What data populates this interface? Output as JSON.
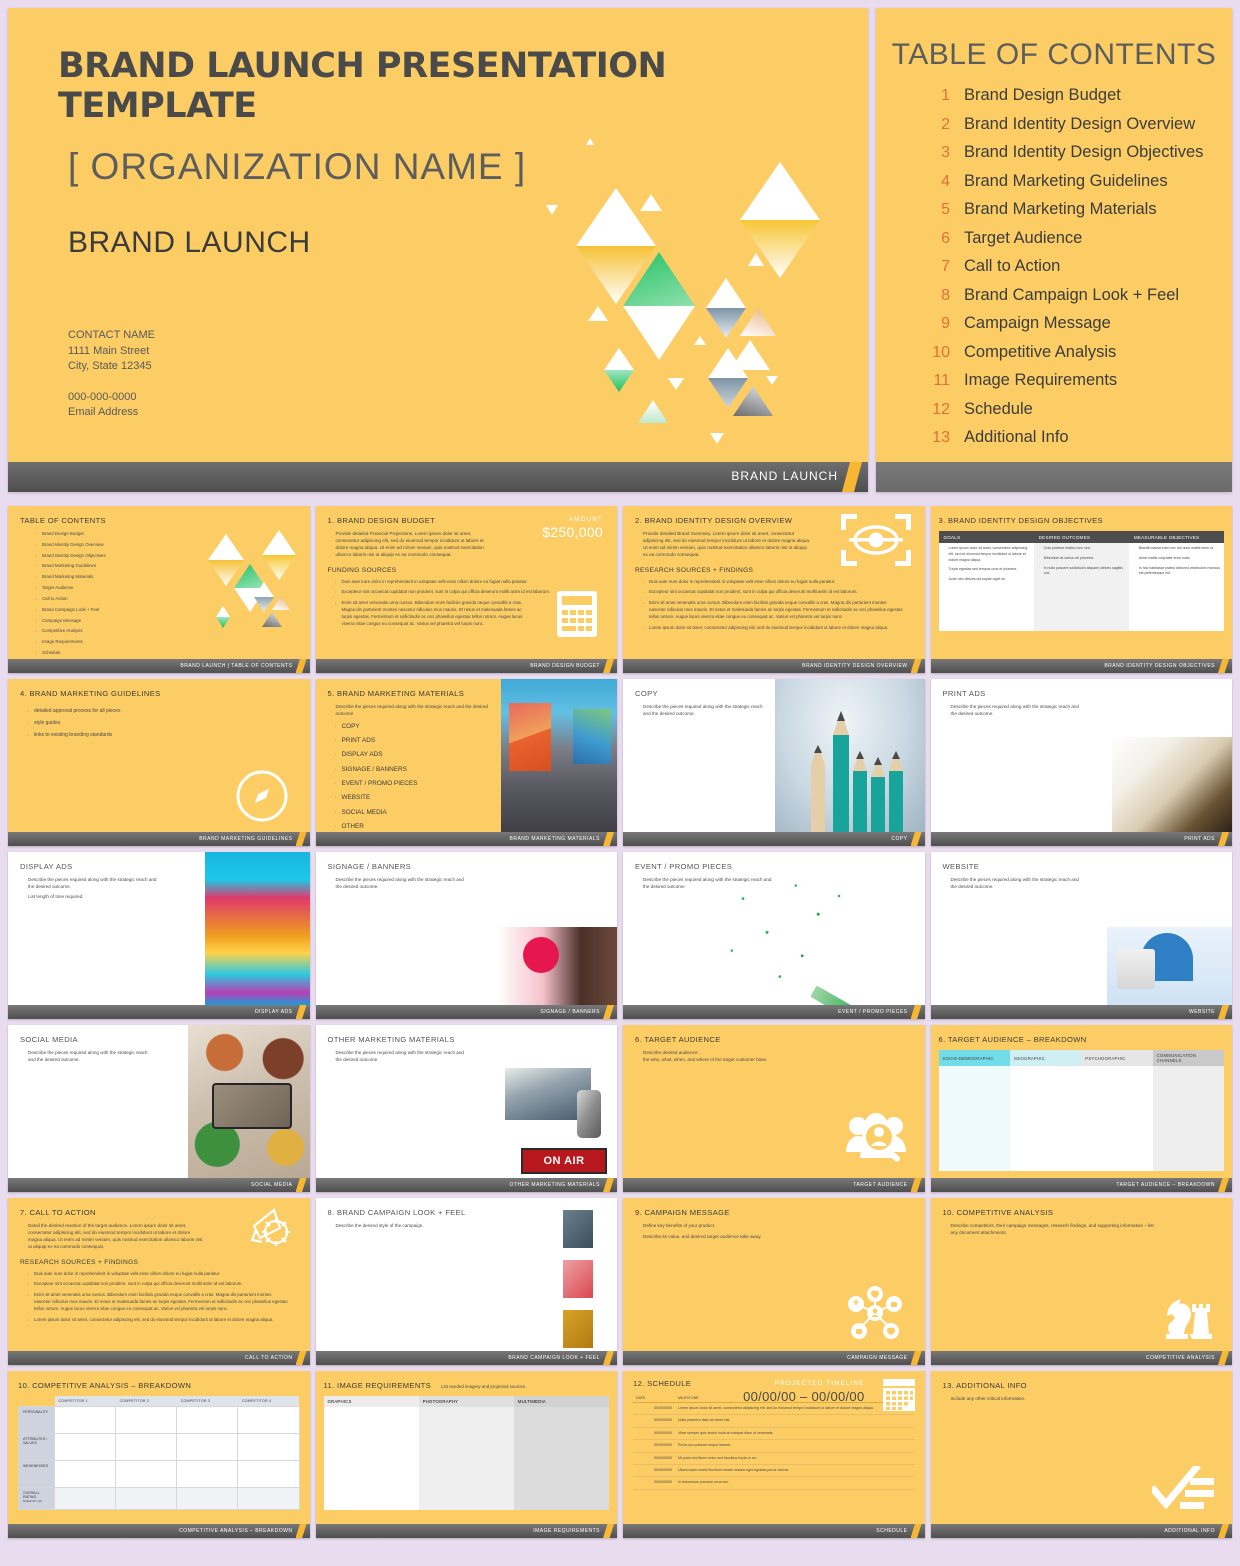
{
  "hero": {
    "title": "BRAND LAUNCH PRESENTATION TEMPLATE",
    "organization": "[ ORGANIZATION NAME ]",
    "subtitle": "BRAND LAUNCH",
    "contact_name": "CONTACT NAME",
    "address_line1": "1111 Main Street",
    "address_line2": "City, State 12345",
    "phone": "000-000-0000",
    "email": "Email Address",
    "footer_label": "BRAND LAUNCH"
  },
  "toc": {
    "heading": "TABLE OF CONTENTS",
    "items": [
      {
        "num": "1",
        "label": "Brand Design Budget"
      },
      {
        "num": "2",
        "label": "Brand Identity Design Overview"
      },
      {
        "num": "3",
        "label": "Brand Identity Design Objectives"
      },
      {
        "num": "4",
        "label": "Brand Marketing Guidelines"
      },
      {
        "num": "5",
        "label": "Brand Marketing Materials"
      },
      {
        "num": "6",
        "label": "Target Audience"
      },
      {
        "num": "7",
        "label": "Call to Action"
      },
      {
        "num": "8",
        "label": "Brand Campaign Look + Feel"
      },
      {
        "num": "9",
        "label": "Campaign Message"
      },
      {
        "num": "10",
        "label": "Competitive Analysis"
      },
      {
        "num": "11",
        "label": "Image Requirements"
      },
      {
        "num": "12",
        "label": "Schedule"
      },
      {
        "num": "13",
        "label": "Additional Info"
      }
    ]
  },
  "colors": {
    "brand_yellow": "#fbcd64",
    "page_background": "#e9dcee",
    "footer_grey": "#4f4f4f",
    "accent_orange": "#e2703a",
    "slash_yellow": "#f7b733"
  },
  "slides": {
    "toc": {
      "title": "TABLE OF CONTENTS",
      "footer": "BRAND LAUNCH  |  TABLE OF CONTENTS"
    },
    "budget": {
      "title": "1. BRAND DESIGN BUDGET",
      "amount_label": "AMOUNT",
      "amount_value": "$250,000",
      "body": "Provide detailed Financial Projections. Lorem ipsum dolor sit amet, consectetur adipiscing elit, sed do eiusmod tempor incididunt ut labore et dolore magna aliqua. Ut enim ad minim veniam, quis nostrud exercitation ullamco laboris nisi ut aliquip ex ea commodo consequat.",
      "section": "FUNDING SOURCES",
      "bullets": [
        "Duis aute irure dolor in reprehenderit in voluptate velit esse cillum dolore eu fugiat nulla pariatur.",
        "Excepteur sint occaecat cupidatat non proident, sunt in culpa qui officia deserunt mollit anim id est laborum.",
        "Enim sit amet venenatis urna cursus. Bibendum enim facilisis gravida neque convallis a cras. Magna dis parturient montes nascetur ridiculus mus mauris. Et netus et malesuada fames ac turpis egestas. Fermentum et sollicitudin ac orci phasellus egestas tellus rutrum. Augue lacus viverra vitae congue eu consequat ac. Varius vel pharetra vel turpis nunc."
      ],
      "footer": "BRAND DESIGN BUDGET"
    },
    "overview": {
      "title": "2. BRAND IDENTITY DESIGN OVERVIEW",
      "body": "Provide detailed Brand Summary. Lorem ipsum dolor sit amet, consectetur adipiscing elit, sed do eiusmod tempor incididunt ut labore et dolore magna aliqua. Ut enim ad minim veniam, quis nostrud exercitation ullamco laboris nisi ut aliquip ex ea commodo consequat.",
      "section": "RESEARCH SOURCES + FINDINGS",
      "bullets": [
        "Duis aute irure dolor in reprehenderit in voluptate velit esse cillum dolore eu fugiat nulla pariatur.",
        "Excepteur sint occaecat cupidatat non proident, sunt in culpa qui officia deserunt mollit anim id est laborum.",
        "Enim sit amet venenatis urna cursus. Bibendum enim facilisis gravida neque convallis a cras. Magna dis parturient montes nascetur ridiculus mus mauris. Et netus et malesuada fames ac turpis egestas. Fermentum et sollicitudin ac orci phasellus egestas tellus rutrum. Augue lacus viverra vitae congue eu consequat ac. Varius vel pharetra vel turpis nunc.",
        "Lorem ipsum dolor sit amet, consectetur adipiscing elit, sed do eiusmod tempor incididunt ut labore et dolore magna aliqua."
      ],
      "footer": "BRAND IDENTITY DESIGN OVERVIEW"
    },
    "objectives": {
      "title": "3. BRAND IDENTITY DESIGN OBJECTIVES",
      "columns": [
        "GOALS",
        "DESIRED OUTCOMES",
        "MEASURABLE OBJECTIVES"
      ],
      "goals": [
        "Lorem ipsum dolor sit amet, consectetur adipiscing elit, sed do eiusmod tempor incididunt ut labore et dolore magna aliqua.",
        "Turpis egestas sed tempus urna et pharetra.",
        "Justo nec ultrices dui sapien eget mi."
      ],
      "outcomes": [
        "Cras pulvinar mattis nunc sed.",
        "Bibendum at varius vel pharetra.",
        "In nulla posuere sollicitudin aliquam ultrices sagittis orci."
      ],
      "measurable": [
        "Blandit massa enim nec dui nunc mattis enim ut.",
        "Amet mattis vulputate enim nulla.",
        "In hac habitasse platea dictumst vestibulum rhoncus est pellentesque elit."
      ],
      "footer": "BRAND IDENTITY DESIGN OBJECTIVES"
    },
    "guidelines": {
      "title": "4. BRAND MARKETING GUIDELINES",
      "bullets": [
        "detailed approval process for all pieces",
        "style guides",
        "links to existing branding standards"
      ],
      "footer": "BRAND MARKETING GUIDELINES"
    },
    "materials": {
      "title": "5. BRAND MARKETING MATERIALS",
      "body": "Describe the pieces required along with the strategic reach and the desired outcome",
      "items": [
        "COPY",
        "PRINT ADS",
        "DISPLAY ADS",
        "SIGNAGE / BANNERS",
        "EVENT / PROMO PIECES",
        "WEBSITE",
        "SOCIAL MEDIA",
        "OTHER"
      ],
      "footer": "BRAND MARKETING MATERIALS"
    },
    "copy": {
      "title": "COPY",
      "body": "Describe the pieces required along with the strategic reach and the desired outcome.",
      "footer": "COPY"
    },
    "print_ads": {
      "title": "PRINT ADS",
      "body": "Describe the pieces required along with the strategic reach and the desired outcome.",
      "footer": "PRINT ADS"
    },
    "display_ads": {
      "title": "DISPLAY ADS",
      "body": "Describe the pieces required along with the strategic reach and the desired outcome.",
      "body2": "List length of time required.",
      "footer": "DISPLAY ADS"
    },
    "signage": {
      "title": "SIGNAGE / BANNERS",
      "body": "Describe the pieces required along with the strategic reach and the desired outcome.",
      "footer": "SIGNAGE / BANNERS"
    },
    "event": {
      "title": "EVENT / PROMO PIECES",
      "body": "Describe the pieces required along with the strategic reach and the desired outcome",
      "footer": "EVENT / PROMO PIECES"
    },
    "website": {
      "title": "WEBSITE",
      "body": "Describe the pieces required along with the strategic reach and the desired outcome.",
      "footer": "WEBSITE"
    },
    "social": {
      "title": "SOCIAL MEDIA",
      "body": "Describe the pieces required along with the strategic reach and the desired outcome.",
      "footer": "SOCIAL MEDIA"
    },
    "other_materials": {
      "title": "OTHER MARKETING MATERIALS",
      "body": "Describe the pieces required along with the strategic reach and the desired outcome.",
      "sign_text": "ON AIR",
      "footer": "OTHER MARKETING MATERIALS"
    },
    "audience": {
      "title": "6. TARGET AUDIENCE",
      "body": "Describe desired audience:\nthe who, what, when, and where of the target customer base.",
      "footer": "TARGET AUDIENCE"
    },
    "audience_breakdown": {
      "title": "6. TARGET AUDIENCE  –  BREAKDOWN",
      "columns": [
        "SOCIO-DEMOGRAPHIC",
        "GEOGRAPHIC",
        "PSYCHOGRAPHIC",
        "COMMUNICATION CHANNELS"
      ],
      "footer": "TARGET AUDIENCE  –  BREAKDOWN"
    },
    "cta": {
      "title": "7. CALL TO ACTION",
      "body": "Detail the desired reaction of the target audience. Lorem ipsum dolor sit amet, consectetur adipiscing elit, sed do eiusmod tempor incididunt ut labore et dolore magna aliqua. Ut enim ad minim veniam, quis nostrud exercitation ullamco laboris nisi ut aliquip ex ea commodo consequat.",
      "section": "RESEARCH SOURCES + FINDINGS",
      "bullets": [
        "Duis aute irure dolor in reprehenderit in voluptate velit esse cillum dolore eu fugiat nulla pariatur.",
        "Excepteur sint occaecat cupidatat non proident, sunt in culpa qui officia deserunt mollit anim id est laborum.",
        "Enim sit amet venenatis urna cursus. Bibendum enim facilisis gravida neque convallis a cras. Magna dis parturient montes nascetur ridiculus mus mauris. Et netus et malesuada fames ac turpis egestas. Fermentum et sollicitudin ac orci phasellus egestas tellus rutrum. Augue lacus viverra vitae congue eu consequat ac. Varius vel pharetra vel turpis nunc.",
        "Lorem ipsum dolor sit amet, consectetur adipiscing elit, sed do eiusmod tempor incididunt ut labore et dolore magna aliqua."
      ],
      "footer": "CALL TO ACTION"
    },
    "look_feel": {
      "title": "8. BRAND CAMPAIGN LOOK + FEEL",
      "body": "Describe the desired style of the campaign.",
      "footer": "BRAND CAMPAIGN LOOK + FEEL"
    },
    "message": {
      "title": "9. CAMPAIGN MESSAGE",
      "body": "Define key benefits of your product.",
      "body2": "Describe its value, and desired target audience take away.",
      "footer": "CAMPAIGN MESSAGE"
    },
    "competitive": {
      "title": "10. COMPETITIVE ANALYSIS",
      "body": "Describe competitors, their campaign messages, research findings, and supporting information – list any document attachments.",
      "footer": "COMPETITIVE ANALYSIS"
    },
    "competitive_breakdown": {
      "title": "10. COMPETITIVE ANALYSIS – BREAKDOWN",
      "columns": [
        "",
        "COMPETITOR 1",
        "COMPETITOR 2",
        "COMPETITOR 3",
        "COMPETITOR 4"
      ],
      "rows": [
        "PERSONALITY",
        "ATTRIBUTES / VALUES",
        "WEAKNESSES",
        "OVERALL RATING"
      ],
      "rating_note": "SCALE OF 1-10",
      "footer": "COMPETITIVE ANALYSIS  –  BREAKDOWN"
    },
    "image_requirements": {
      "title": "11. IMAGE REQUIREMENTS",
      "subtitle": "List needed imagery and projected sources.",
      "columns": [
        "GRAPHICS",
        "PHOTOGRAPHY",
        "MULTIMEDIA"
      ],
      "footer": "IMAGE REQUIREMENTS"
    },
    "schedule": {
      "title": "12. SCHEDULE",
      "timeline_label": "PROJECTED TIMELINE",
      "timeline_range": "00/00/00 – 00/00/00",
      "columns": [
        "DATE",
        "MILESTONE"
      ],
      "rows": [
        {
          "date": "00/00/0000",
          "milestone": "Lorem ipsum dolor sit amet, consectetur adipiscing elit, sed do eiusmod tempor incididunt ut labore et dolore magna aliqua."
        },
        {
          "date": "00/00/0000",
          "milestone": "Nulla pharetra diam sit amet nisl."
        },
        {
          "date": "00/00/0000",
          "milestone": "Vitae semper quis lectus nulla at volutpat diam ut venenatis."
        },
        {
          "date": "00/00/0000",
          "milestone": "Porta non pulvinar neque laoreet."
        },
        {
          "date": "00/00/0000",
          "milestone": "Mi proin sed libero enim sed faucibus turpis in eu."
        },
        {
          "date": "00/00/0000",
          "milestone": "Ullamcorper morbi tincidunt ornare massa eget egestas purus viverra."
        },
        {
          "date": "00/00/0000",
          "milestone": "In fermentum posuere urna nec."
        }
      ],
      "footer": "SCHEDULE"
    },
    "additional": {
      "title": "13. ADDITIONAL INFO",
      "body": "Include any other critical information.",
      "footer": "ADDITIONAL INFO"
    }
  }
}
